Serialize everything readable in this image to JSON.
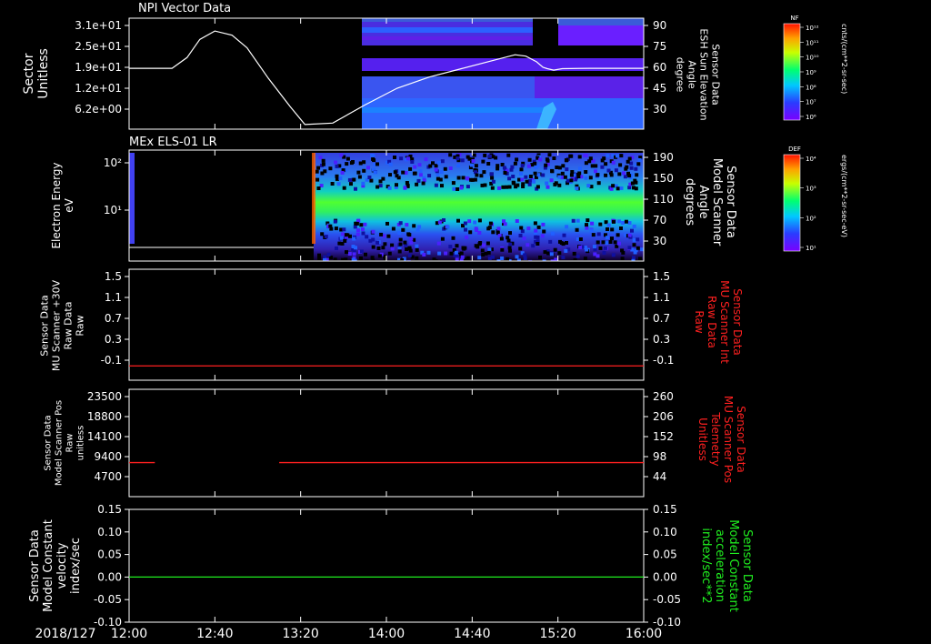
{
  "colors": {
    "white": "#ffffff",
    "red": "#ff2020",
    "green": "#20ee20"
  },
  "date_label": "2018/127",
  "time_ticks": [
    "12:00",
    "12:40",
    "13:20",
    "14:00",
    "14:40",
    "15:20",
    "16:00"
  ],
  "chart_data": [
    {
      "type": "heatmap",
      "title": "NPI Vector Data",
      "ylabel": "Sector\nUnitless",
      "y_ticks": [
        "3.1e+01",
        "2.5e+01",
        "1.9e+01",
        "1.2e+01",
        "6.2e+00"
      ],
      "right_ticks": [
        "90",
        "75",
        "60",
        "45",
        "30"
      ],
      "right_label": "Sensor Data\nESH Sun Elevation\nAngle\ndegree",
      "colorbar": {
        "title": "NF",
        "unit": "cnts/(cm**2-sr-sec)",
        "ticks": [
          "10¹²",
          "10¹¹",
          "10¹⁰",
          "10⁹",
          "10⁸",
          "10⁷",
          "10⁶"
        ]
      },
      "data_start": "13:35",
      "curve": {
        "x": [
          "12:00",
          "12:20",
          "12:27",
          "12:33",
          "12:40",
          "12:48",
          "12:55",
          "13:05",
          "13:15",
          "13:22",
          "13:35",
          "13:50",
          "14:05",
          "14:20",
          "14:35",
          "14:50",
          "15:00",
          "15:05",
          "15:10",
          "15:13",
          "15:15",
          "15:18",
          "15:22",
          "15:35",
          "16:00"
        ],
        "y": [
          59.3,
          59.3,
          67,
          80,
          86,
          83,
          74,
          52,
          32,
          19,
          20,
          33,
          45,
          53,
          59,
          65,
          69,
          68,
          64,
          60,
          59,
          58,
          59,
          59.3,
          59.3
        ]
      }
    },
    {
      "type": "heatmap",
      "title": "MEx ELS-01 LR",
      "ylabel": "Electron Energy\neV",
      "y_ticks": [
        "10²",
        "10¹"
      ],
      "right_ticks": [
        "190",
        "150",
        "110",
        "70",
        "30"
      ],
      "right_label": "Sensor Data\nModel Scanner\nAngle\ndegrees",
      "colorbar": {
        "title": "DEF",
        "unit": "ergs/(cm**2-sr-sec-eV)",
        "ticks": [
          "10⁴",
          "10³",
          "10²",
          "10¹"
        ]
      },
      "data_start": "13:22"
    },
    {
      "type": "line",
      "ylabel": "Sensor Data\nMU Scanner +30V\nRaw Data\nRaw",
      "y_ticks": [
        "1.5",
        "1.1",
        "0.7",
        "0.3",
        "-0.1"
      ],
      "right_ticks": [
        "1.5",
        "1.1",
        "0.7",
        "0.3",
        "-0.1"
      ],
      "right_label": "Sensor Data\nMU Scanner Int\nRaw Data\nRaw",
      "ylim": [
        -0.3,
        1.5
      ],
      "series": [
        {
          "x": [
            "12:00",
            "16:00"
          ],
          "y": [
            0,
            0
          ]
        }
      ]
    },
    {
      "type": "line",
      "ylabel": "Sensor Data\nModel Scanner Pos\nRaw\nunitless",
      "y_ticks": [
        "23500",
        "18800",
        "14100",
        "9400",
        "4700"
      ],
      "right_ticks": [
        "260",
        "206",
        "152",
        "98",
        "44"
      ],
      "right_label": "Sensor Data\nMU Scanner Pos\nTelemetry\nUnitless",
      "ylim": [
        0,
        23500
      ],
      "series": [
        {
          "segments": [
            {
              "x": [
                "12:00",
                "12:12"
              ],
              "y": [
                8000,
                8000
              ]
            },
            {
              "x": [
                "13:10",
                "16:00"
              ],
              "y": [
                8000,
                8000
              ]
            }
          ]
        }
      ]
    },
    {
      "type": "line",
      "ylabel": "Sensor Data\nModel Constant\nvelocity\nindex/sec",
      "y_ticks": [
        "0.15",
        "0.10",
        "0.05",
        "0.00",
        "-0.05",
        "-0.10"
      ],
      "right_ticks": [
        "0.15",
        "0.10",
        "0.05",
        "0.00",
        "-0.05",
        "-0.10"
      ],
      "right_label": "Sensor Data\nModel Constant\nacceleration\nindex/sec**2",
      "ylim": [
        -0.1,
        0.15
      ],
      "series": [
        {
          "x": [
            "12:00",
            "16:00"
          ],
          "y": [
            0,
            0
          ]
        }
      ]
    }
  ]
}
